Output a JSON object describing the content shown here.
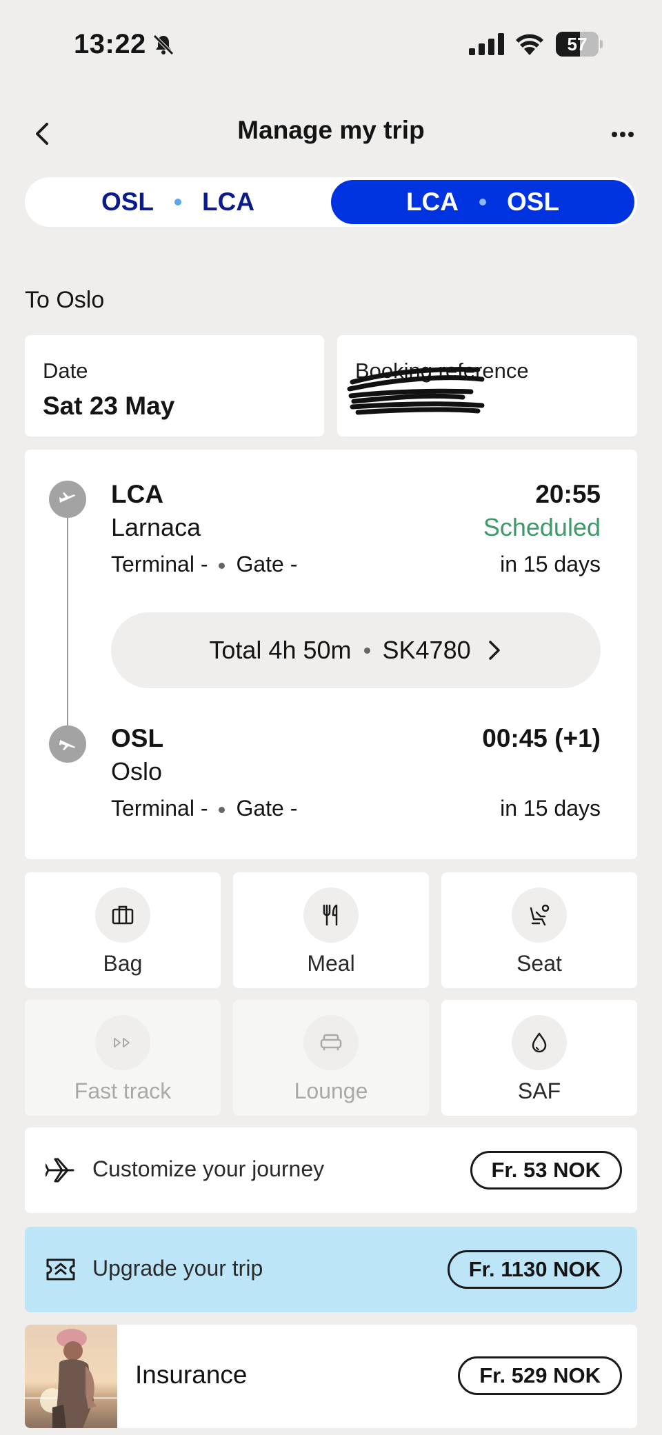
{
  "status_bar": {
    "time": "13:22",
    "battery": "57",
    "battery_level": 0.57
  },
  "header": {
    "title": "Manage my trip"
  },
  "segments": [
    {
      "from": "OSL",
      "to": "LCA",
      "active": false
    },
    {
      "from": "LCA",
      "to": "OSL",
      "active": true
    }
  ],
  "section_title": "To Oslo",
  "date_card": {
    "label": "Date",
    "value": "Sat 23 May"
  },
  "booking_card": {
    "label": "Booking reference"
  },
  "departure": {
    "code": "LCA",
    "city": "Larnaca",
    "terminal": "Terminal -",
    "gate": "Gate -",
    "time": "20:55",
    "status": "Scheduled",
    "relative": "in 15 days"
  },
  "duration": {
    "total": "Total 4h 50m",
    "flight": "SK4780"
  },
  "arrival": {
    "code": "OSL",
    "city": "Oslo",
    "terminal": "Terminal -",
    "gate": "Gate -",
    "time": "00:45 (+1)",
    "relative": "in 15 days"
  },
  "services": [
    {
      "label": "Bag",
      "icon": "bag-icon",
      "enabled": true
    },
    {
      "label": "Meal",
      "icon": "meal-icon",
      "enabled": true
    },
    {
      "label": "Seat",
      "icon": "seat-icon",
      "enabled": true
    },
    {
      "label": "Fast track",
      "icon": "fast-track-icon",
      "enabled": false
    },
    {
      "label": "Lounge",
      "icon": "lounge-icon",
      "enabled": false
    },
    {
      "label": "SAF",
      "icon": "droplet-icon",
      "enabled": true
    }
  ],
  "offers": {
    "customize": {
      "label": "Customize your journey",
      "price": "Fr. 53 NOK",
      "icon": "plane-icon"
    },
    "upgrade": {
      "label": "Upgrade your trip",
      "price": "Fr. 1130 NOK",
      "icon": "upgrade-ticket-icon"
    },
    "insurance": {
      "label": "Insurance",
      "price": "Fr. 529 NOK"
    }
  },
  "colors": {
    "brand_blue": "#0033e0",
    "scheduled_green": "#3b9a68",
    "upgrade_bg": "#bde5f8"
  }
}
